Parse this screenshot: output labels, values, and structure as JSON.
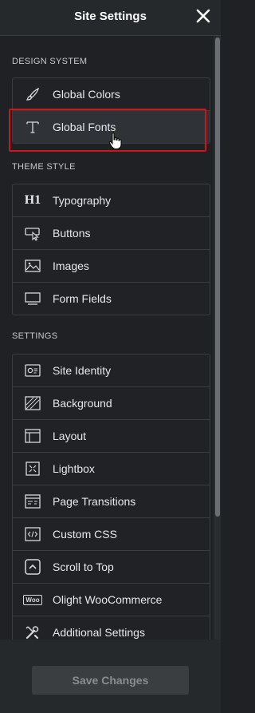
{
  "header": {
    "title": "Site Settings",
    "close_icon": "close-icon"
  },
  "sections": {
    "design_system": {
      "title": "DESIGN SYSTEM",
      "items": [
        {
          "label": "Global Colors",
          "icon": "paintbrush-icon"
        },
        {
          "label": "Global Fonts",
          "icon": "typeface-icon"
        }
      ]
    },
    "theme_style": {
      "title": "THEME STYLE",
      "items": [
        {
          "label": "Typography",
          "icon": "heading-h1-icon",
          "icon_text": "H1"
        },
        {
          "label": "Buttons",
          "icon": "button-cursor-icon"
        },
        {
          "label": "Images",
          "icon": "image-icon"
        },
        {
          "label": "Form Fields",
          "icon": "form-field-icon"
        }
      ]
    },
    "settings": {
      "title": "SETTINGS",
      "items": [
        {
          "label": "Site Identity",
          "icon": "site-identity-icon"
        },
        {
          "label": "Background",
          "icon": "background-icon"
        },
        {
          "label": "Layout",
          "icon": "layout-icon"
        },
        {
          "label": "Lightbox",
          "icon": "lightbox-icon"
        },
        {
          "label": "Page Transitions",
          "icon": "page-transitions-icon"
        },
        {
          "label": "Custom CSS",
          "icon": "custom-css-icon"
        },
        {
          "label": "Scroll to Top",
          "icon": "scroll-to-top-icon"
        },
        {
          "label": "Olight WooCommerce",
          "icon": "woocommerce-icon",
          "icon_text": "Woo"
        },
        {
          "label": "Additional Settings",
          "icon": "tools-icon"
        }
      ]
    }
  },
  "footer": {
    "save_label": "Save Changes"
  },
  "colors": {
    "background": "#1f2124",
    "panel": "#26292c",
    "border": "#3a3d40",
    "highlight": "#d0141a"
  }
}
